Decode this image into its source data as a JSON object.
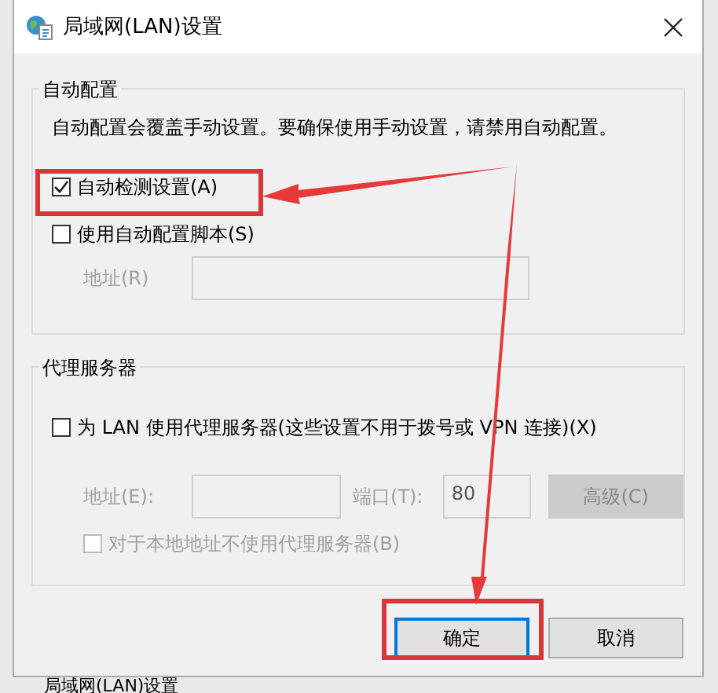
{
  "window": {
    "title": "局域网(LAN)设置"
  },
  "auto_config": {
    "title": "自动配置",
    "description": "自动配置会覆盖手动设置。要确保使用手动设置，请禁用自动配置。",
    "auto_detect": {
      "label": "自动检测设置(A)",
      "checked": true
    },
    "use_script": {
      "label": "使用自动配置脚本(S)",
      "checked": false
    },
    "address": {
      "label": "地址(R)",
      "disabled": true
    }
  },
  "proxy": {
    "title": "代理服务器",
    "use_proxy": {
      "label": "为 LAN 使用代理服务器(这些设置不用于拨号或 VPN 连接)(X)",
      "checked": false
    },
    "address": {
      "label": "地址(E):",
      "disabled": true
    },
    "port": {
      "label": "端口(T):",
      "value": "80",
      "disabled": true
    },
    "advanced": {
      "label": "高级(C)",
      "disabled": true
    },
    "bypass": {
      "label": "对于本地地址不使用代理服务器(B)",
      "checked": false,
      "disabled": true
    }
  },
  "buttons": [
    {
      "label": "确定",
      "default": true
    },
    {
      "label": "取消",
      "default": false
    }
  ],
  "background_window": {
    "title": "局域网(LAN)设置"
  }
}
